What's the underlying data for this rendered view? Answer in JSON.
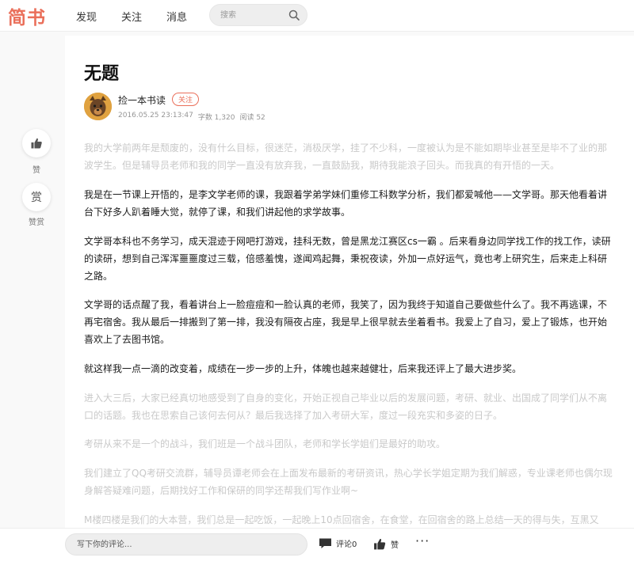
{
  "header": {
    "logo": "简书",
    "nav": [
      "发现",
      "关注",
      "消息"
    ],
    "search_placeholder": "搜索"
  },
  "article": {
    "title": "无题",
    "author": "捡一本书读",
    "follow_label": "关注",
    "date": "2016.05.25 23:13:47",
    "word_count": "字数 1,320",
    "reads": "阅读 52",
    "paragraphs": [
      "我的大学前两年是颓废的，没有什么目标，很迷茫，消极厌学，挂了不少科，一度被认为是不能如期毕业甚至是毕不了业的那波学生。但是辅导员老师和我的同学一直没有放弃我，一直鼓励我，期待我能浪子回头。而我真的有开悟的一天。",
      "我是在一节课上开悟的，是李文学老师的课，我跟着学弟学妹们重修工科数学分析，我们都爱喊他——文学哥。那天他看着讲台下好多人趴着睡大觉，就停了课，和我们讲起他的求学故事。",
      "文学哥本科也不务学习，成天混迹于网吧打游戏，挂科无数，曾是黑龙江赛区cs一霸 。后来看身边同学找工作的找工作，读研的读研，想到自己浑浑噩噩度过三载，倍感羞愧，遂闻鸡起舞，秉祝夜读，外加一点好运气，竟也考上研究生，后来走上科研之路。",
      "文学哥的话点醒了我，看着讲台上一脸痘痘和一脸认真的老师，我笑了，因为我终于知道自己要做些什么了。我不再逃课，不再宅宿舍。我从最后一排搬到了第一排，我没有隔夜占座，我是早上很早就去坐着看书。我爱上了自习，爱上了锻炼，也开始喜欢上了去图书馆。",
      "就这样我一点一滴的改变着，成绩在一步一步的上升，体魄也越来越健壮，后来我还评上了最大进步奖。",
      "进入大三后，大家已经真切地感受到了自身的变化，开始正视自己毕业以后的发展问题，考研、就业、出国成了同学们从不离口的话题。我也在思索自己该何去何从？最后我选择了加入考研大军，度过一段充实和多姿的日子。",
      "考研从来不是一个的战斗，我们班是一个战斗团队，老师和学长学姐们是最好的助攻。",
      "我们建立了QQ考研交流群，辅导员谭老师会在上面发布最新的考研资讯，热心学长学姐定期为我们解惑，专业课老师也偶尔现身解答疑难问题，后期找好工作和保研的同学还帮我们写作业啊~",
      "M楼四楼是我们的大本营，我们总是一起吃饭，一起晚上10点回宿舍，在食堂，在回宿舍的路上总结一天的得与失，互黑又"
    ]
  },
  "side": {
    "like_label": "赞",
    "reward_icon_char": "赏",
    "reward_label": "赞赏"
  },
  "bottom": {
    "comment_placeholder": "写下你的评论...",
    "comment_label": "评论0",
    "like_label": "赞",
    "more": "···"
  },
  "colors": {
    "brand": "#ea6f5a",
    "faded_text": "#c9c9c9",
    "main_text": "#1a1a1a"
  }
}
